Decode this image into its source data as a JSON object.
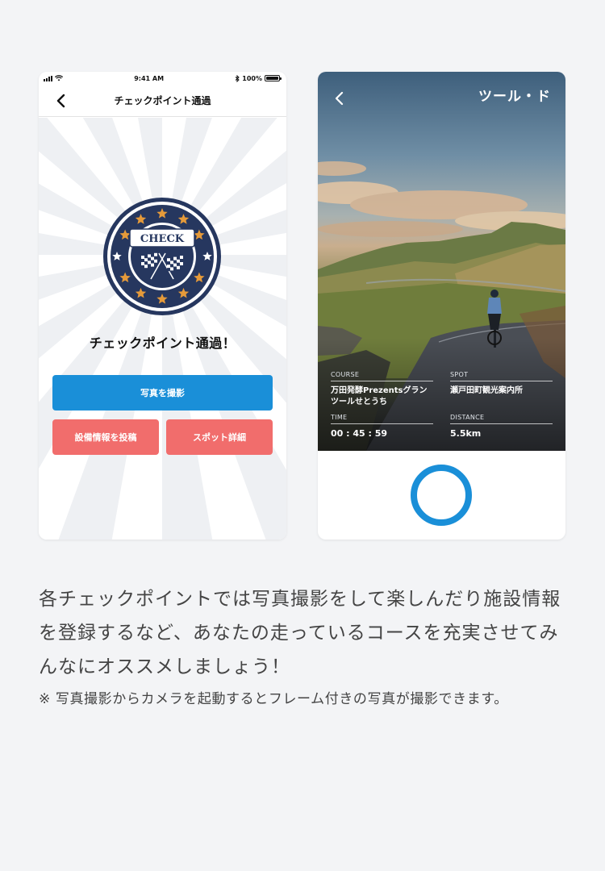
{
  "left_screen": {
    "status": {
      "time": "9:41 AM",
      "battery": "100%"
    },
    "nav": {
      "title": "チェックポイント通過"
    },
    "badge": {
      "text": "CHECK"
    },
    "heading": "チェックポイント通過！",
    "buttons": {
      "take_photo": "写真を撮影",
      "post_facility": "設備情報を投稿",
      "spot_details": "スポット詳細"
    }
  },
  "right_screen": {
    "brand": "ツール・ド",
    "course": {
      "label": "COURSE",
      "value": "万田発酵Prezentsグランツールせとうち"
    },
    "spot": {
      "label": "SPOT",
      "value": "瀬戸田町観光案内所"
    },
    "time": {
      "label": "TIME",
      "value": "00 : 45 : 59"
    },
    "distance": {
      "label": "DISTANCE",
      "value": "5.5km"
    }
  },
  "description": "各チェックポイントでは写真撮影をして楽しんだり施設情報を登録するなど、あなたの走っているコースを充実させてみんなにオススメしましょう！",
  "note": "※ 写真撮影からカメラを起動するとフレーム付きの写真が撮影できます。",
  "colors": {
    "primary_blue": "#1a8fd8",
    "coral": "#f16d6c",
    "badge_navy": "#26375f",
    "badge_star": "#e59a3a"
  },
  "icons": [
    "back-chevron-icon",
    "signal-icon",
    "wifi-icon",
    "bluetooth-icon",
    "battery-icon",
    "checkered-flags-icon",
    "star-icon",
    "shutter-icon"
  ]
}
